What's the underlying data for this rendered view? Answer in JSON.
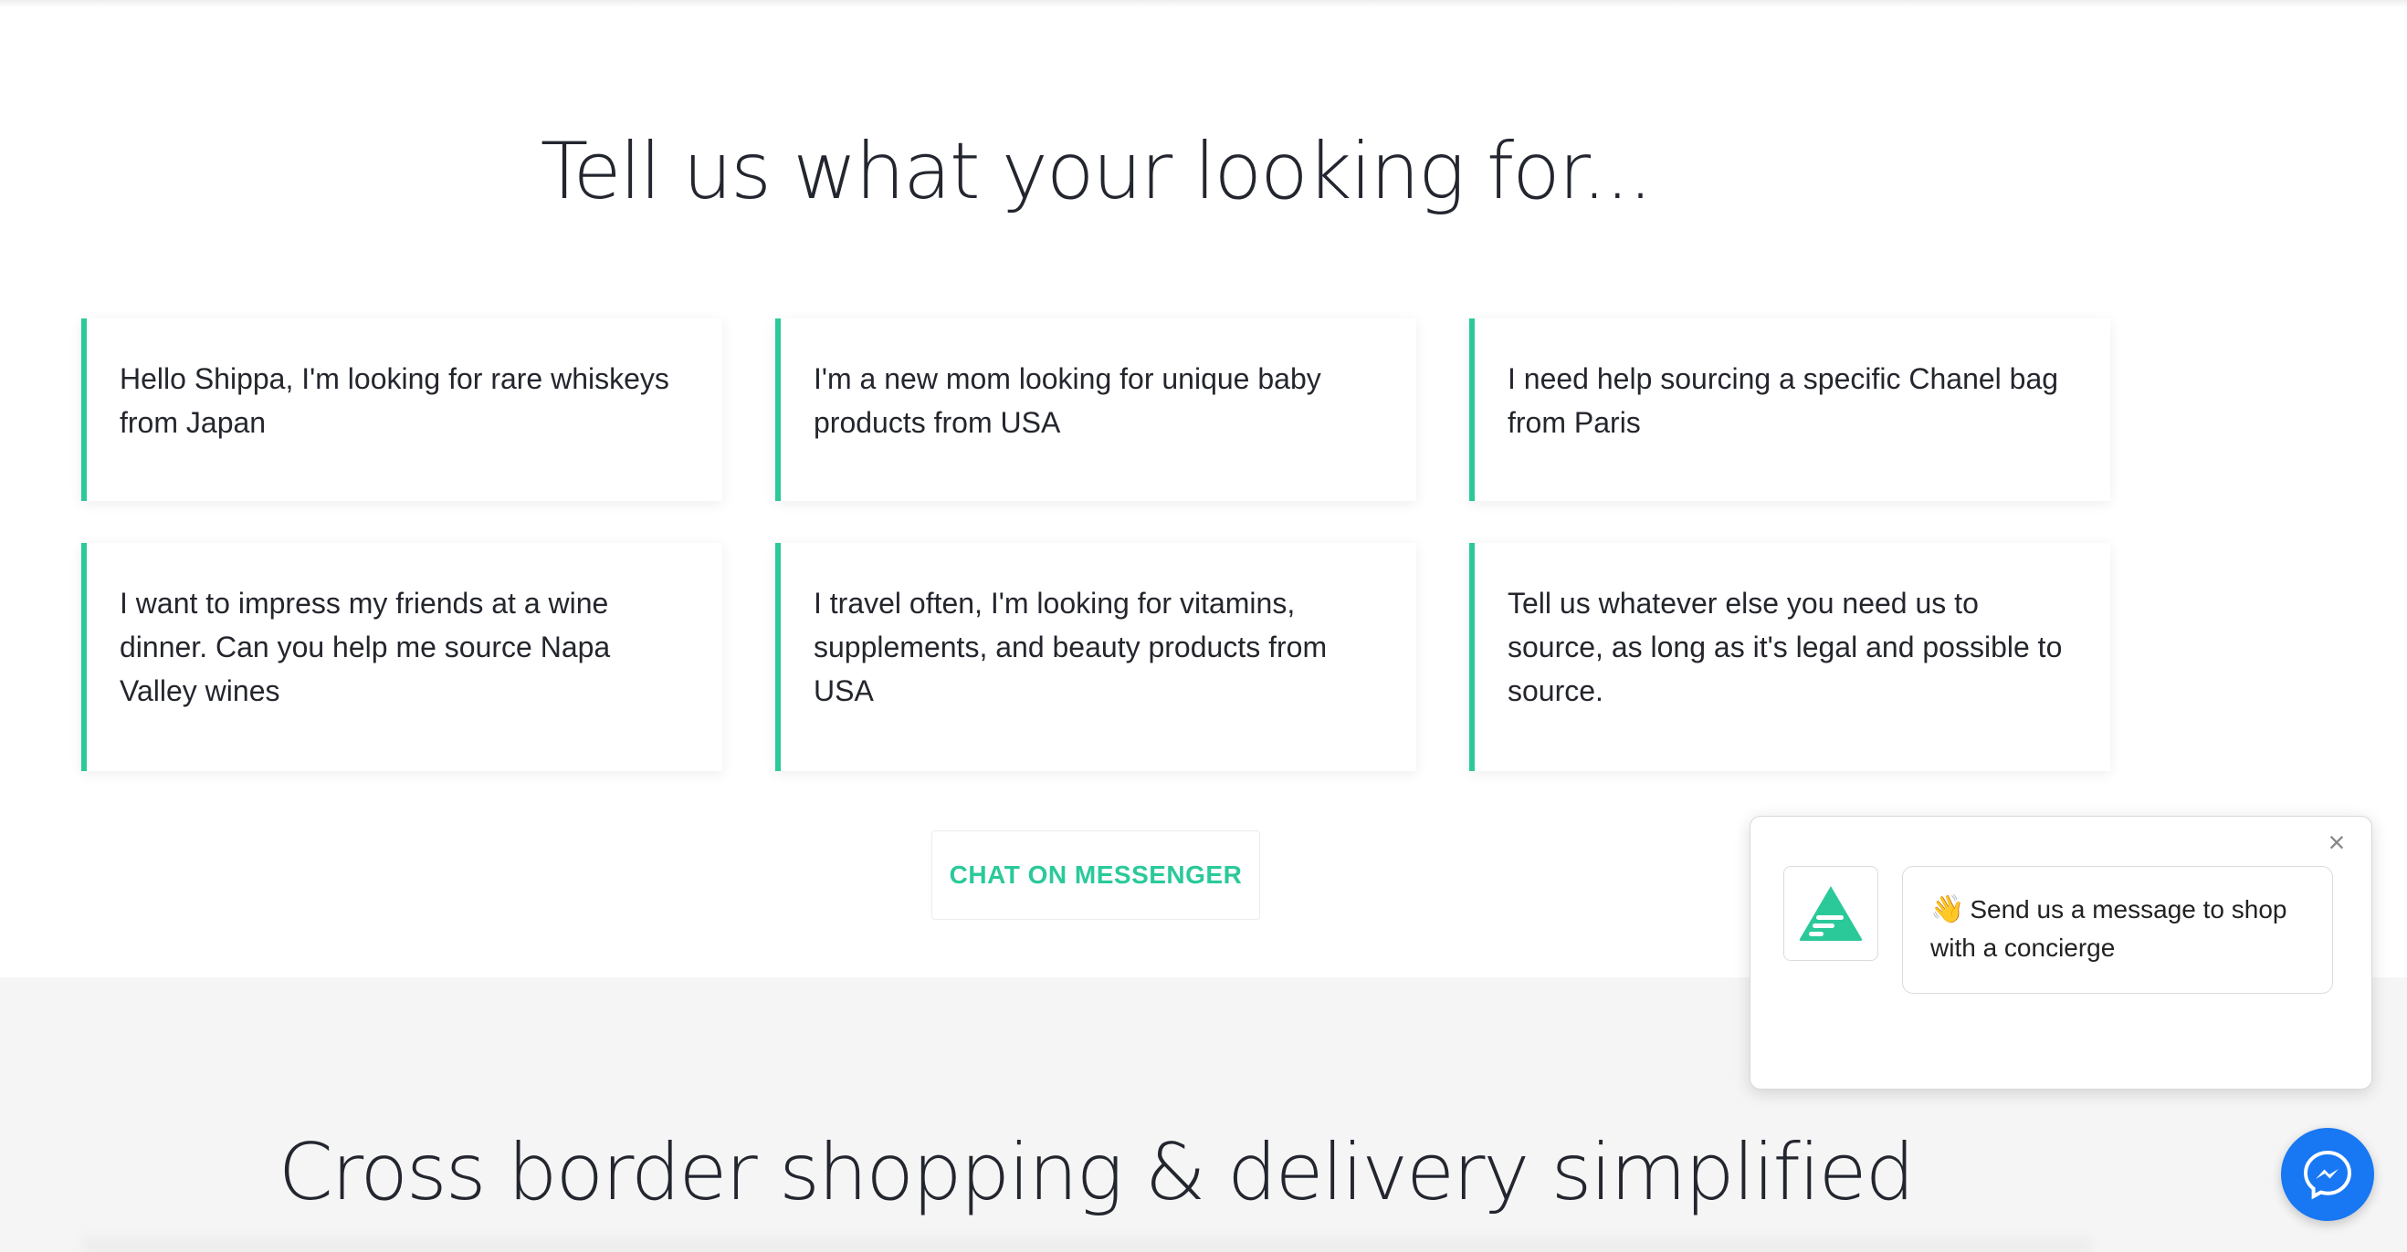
{
  "section": {
    "title": "Tell us what your looking for..."
  },
  "cards": [
    {
      "text": "Hello Shippa, I'm looking for rare whiskeys from Japan"
    },
    {
      "text": "I'm a new mom looking for unique baby products from USA"
    },
    {
      "text": "I need help sourcing a specific Chanel bag from Paris"
    },
    {
      "text": "I want to impress my friends at a wine dinner. Can you help me source Napa Valley wines"
    },
    {
      "text": "I travel often, I'm looking for vitamins, supplements, and beauty products from USA"
    },
    {
      "text": "Tell us whatever else you need us to source, as long as it's legal and possible to source."
    }
  ],
  "cta": {
    "label": "CHAT ON MESSENGER"
  },
  "section2": {
    "title": "Cross border shopping & delivery simplified"
  },
  "chat_widget": {
    "emoji": "👋",
    "message": "Send us a message to shop with a concierge",
    "close_symbol": "×",
    "logo_icon": "shippa-logo-icon"
  },
  "messenger_button": {
    "icon": "messenger-icon"
  },
  "colors": {
    "accent": "#2bc99a",
    "messenger": "#1877f2",
    "gray_section": "#f5f5f5"
  }
}
